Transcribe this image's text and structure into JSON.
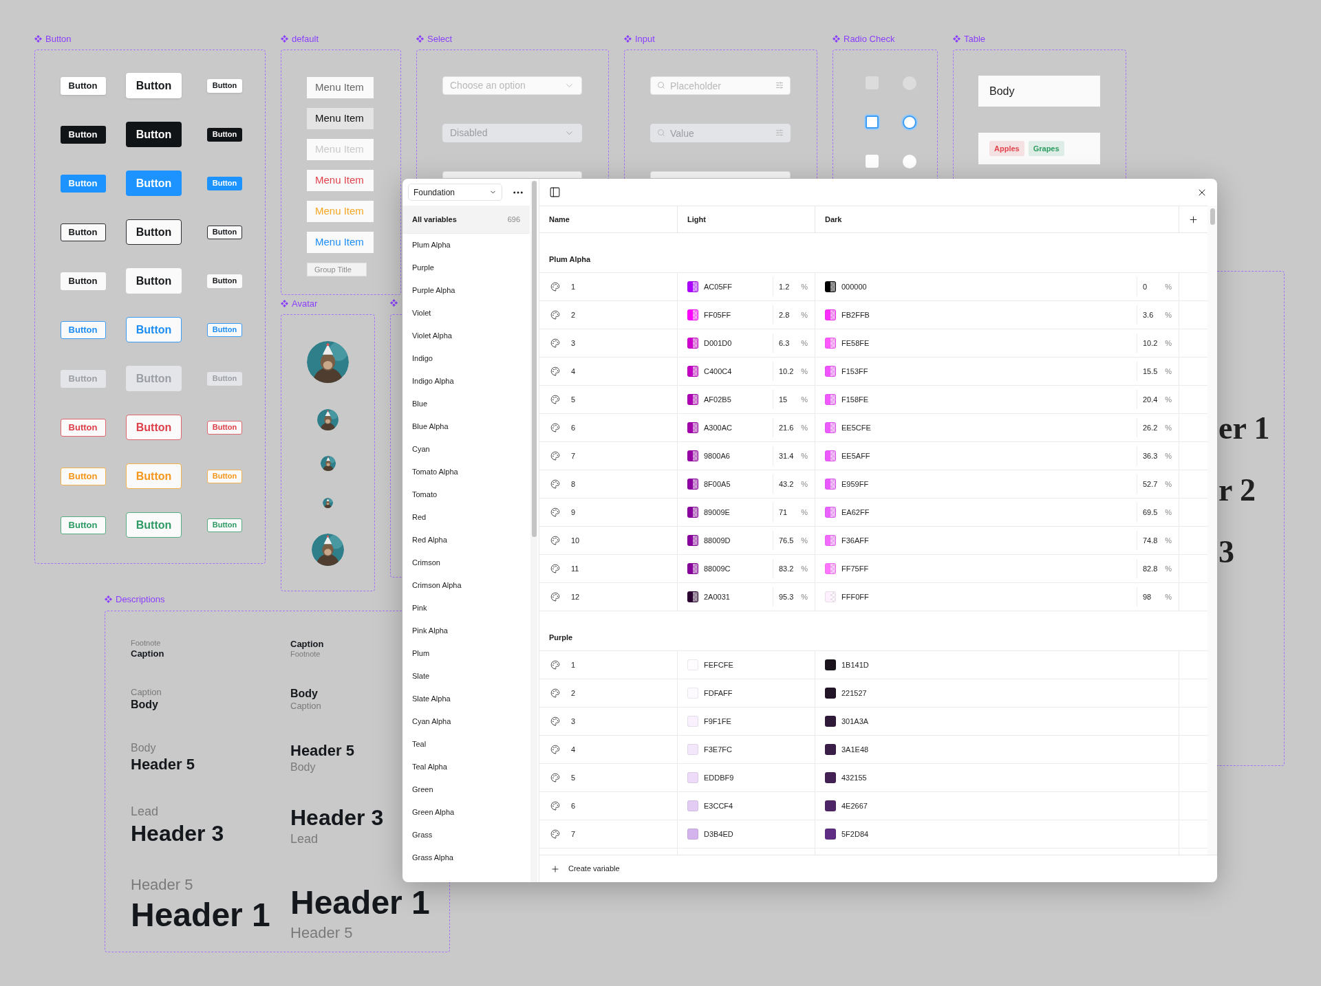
{
  "canvas": {
    "button_frame": {
      "label": "Button",
      "rows": [
        {
          "kind": "default",
          "buttons": [
            "Button",
            "Button",
            "Button"
          ]
        },
        {
          "kind": "dark",
          "buttons": [
            "Button",
            "Button",
            "Button"
          ]
        },
        {
          "kind": "primary",
          "buttons": [
            "Button",
            "Button",
            "Button"
          ]
        },
        {
          "kind": "outline",
          "buttons": [
            "Button",
            "Button",
            "Button"
          ]
        },
        {
          "kind": "plain",
          "buttons": [
            "Button",
            "Button",
            "Button"
          ]
        },
        {
          "kind": "link",
          "buttons": [
            "Button",
            "Button",
            "Button"
          ]
        },
        {
          "kind": "disabled",
          "buttons": [
            "Button",
            "Button",
            "Button"
          ]
        },
        {
          "kind": "danger",
          "buttons": [
            "Button",
            "Button",
            "Button"
          ]
        },
        {
          "kind": "warning",
          "buttons": [
            "Button",
            "Button",
            "Button"
          ]
        },
        {
          "kind": "success",
          "buttons": [
            "Button",
            "Button",
            "Button"
          ]
        }
      ]
    },
    "menu_frame": {
      "label": "default",
      "items": [
        {
          "text": "Menu Item",
          "kind": "default",
          "selected": false
        },
        {
          "text": "Menu Item",
          "kind": "default",
          "selected": true
        },
        {
          "text": "Menu Item",
          "kind": "disabled",
          "selected": false
        },
        {
          "text": "Menu Item",
          "kind": "danger",
          "selected": false
        },
        {
          "text": "Menu Item",
          "kind": "warning",
          "selected": false
        },
        {
          "text": "Menu Item",
          "kind": "primary",
          "selected": false
        },
        {
          "text": "Group Title",
          "kind": "group",
          "selected": false
        }
      ]
    },
    "select_frame": {
      "label": "Select",
      "fields": [
        {
          "kind": "default",
          "placeholder": "Choose an option"
        },
        {
          "kind": "disabled",
          "placeholder": "Disabled"
        },
        {
          "kind": "covered"
        }
      ]
    },
    "input_frame": {
      "label": "Input",
      "fields": [
        {
          "kind": "default",
          "placeholder": "Placeholder"
        },
        {
          "kind": "disabled",
          "value": "Value"
        },
        {
          "kind": "covered"
        }
      ]
    },
    "radio_frame": {
      "label": "Radio Check",
      "rows": [
        {
          "kind": "disabled",
          "checkbox": {
            "checked": false
          },
          "radio": {
            "checked": false
          }
        },
        {
          "kind": "focused",
          "checkbox": {
            "checked": false
          },
          "radio": {
            "checked": false
          }
        },
        {
          "kind": "default",
          "checkbox": {
            "checked": false
          },
          "radio": {
            "checked": false
          }
        }
      ]
    },
    "table_frame": {
      "label": "Table",
      "cell": "Body",
      "tags": [
        {
          "text": "Apples",
          "color": "#e0434d"
        },
        {
          "text": "Grapes",
          "color": "#2c9c62"
        }
      ]
    },
    "avatar_frame": {
      "label": "Avatar",
      "avatars": [
        {
          "kind": "xl"
        },
        {
          "kind": "md"
        },
        {
          "kind": "sm"
        },
        {
          "kind": "xs"
        },
        {
          "kind": "lg"
        }
      ]
    },
    "descriptions_frame": {
      "label": "Descriptions",
      "columns": [
        [
          [
            {
              "text": "Footnote",
              "kind": "footnote"
            },
            {
              "text": "Caption",
              "kind": "caption"
            }
          ],
          [
            {
              "text": "Caption",
              "kind": "caption"
            },
            {
              "text": "Body",
              "kind": "body"
            }
          ],
          [
            {
              "text": "Body",
              "kind": "body"
            },
            {
              "text": "Header 5",
              "kind": "h5"
            }
          ],
          [
            {
              "text": "Lead",
              "kind": "lead"
            },
            {
              "text": "Header 3",
              "kind": "h3"
            }
          ],
          [
            {
              "text": "Header 5",
              "kind": "h5"
            },
            {
              "text": "Header 1",
              "kind": "h1"
            }
          ]
        ],
        [
          [
            {
              "text": "Caption",
              "kind": "caption"
            },
            {
              "text": "Footnote",
              "kind": "footnote"
            }
          ],
          [
            {
              "text": "Body",
              "kind": "body"
            },
            {
              "text": "Caption",
              "kind": "caption"
            }
          ],
          [
            {
              "text": "Header 5",
              "kind": "h5"
            },
            {
              "text": "Body",
              "kind": "body"
            }
          ],
          [
            {
              "text": "Header 3",
              "kind": "h3"
            },
            {
              "text": "Lead",
              "kind": "lead"
            }
          ],
          [
            {
              "text": "Header 1",
              "kind": "h1"
            },
            {
              "text": "Header 5",
              "kind": "h5"
            }
          ]
        ]
      ]
    },
    "heading_frame": {
      "fragments": [
        "er 1",
        "r 2",
        "3"
      ]
    }
  },
  "variables_window": {
    "sidebar": {
      "collection": "Foundation",
      "all": {
        "label": "All variables",
        "count": "696",
        "selected": true
      },
      "groups": [
        {
          "label": "Plum Alpha",
          "selected": false
        },
        {
          "label": "Purple",
          "selected": false
        },
        {
          "label": "Purple Alpha",
          "selected": false
        },
        {
          "label": "Violet",
          "selected": false
        },
        {
          "label": "Violet Alpha",
          "selected": false
        },
        {
          "label": "Indigo",
          "selected": false
        },
        {
          "label": "Indigo Alpha",
          "selected": false
        },
        {
          "label": "Blue",
          "selected": false
        },
        {
          "label": "Blue Alpha",
          "selected": false
        },
        {
          "label": "Cyan",
          "selected": false
        },
        {
          "label": "Tomato Alpha",
          "selected": false
        },
        {
          "label": "Tomato",
          "selected": false
        },
        {
          "label": "Red",
          "selected": false
        },
        {
          "label": "Red Alpha",
          "selected": false
        },
        {
          "label": "Crimson",
          "selected": false
        },
        {
          "label": "Crimson Alpha",
          "selected": false
        },
        {
          "label": "Pink",
          "selected": false
        },
        {
          "label": "Pink Alpha",
          "selected": false
        },
        {
          "label": "Plum",
          "selected": false
        },
        {
          "label": "Slate",
          "selected": false
        },
        {
          "label": "Slate Alpha",
          "selected": false
        },
        {
          "label": "Cyan Alpha",
          "selected": false
        },
        {
          "label": "Teal",
          "selected": false
        },
        {
          "label": "Teal Alpha",
          "selected": false
        },
        {
          "label": "Green",
          "selected": false
        },
        {
          "label": "Green Alpha",
          "selected": false
        },
        {
          "label": "Grass",
          "selected": false
        },
        {
          "label": "Grass Alpha",
          "selected": false
        }
      ]
    },
    "table": {
      "columns": [
        "Name",
        "Light",
        "Dark"
      ],
      "groups": [
        {
          "title": "Plum Alpha",
          "rows": [
            {
              "name": "1",
              "light": {
                "hex": "AC05FF",
                "color": "#ac05ff",
                "alpha": "1.2",
                "unit": "%"
              },
              "dark": {
                "hex": "000000",
                "color": "#000000",
                "alpha": "0",
                "unit": "%"
              }
            },
            {
              "name": "2",
              "light": {
                "hex": "FF05FF",
                "color": "#ff05ff",
                "alpha": "2.8",
                "unit": "%"
              },
              "dark": {
                "hex": "FB2FFB",
                "color": "#fb2ffb",
                "alpha": "3.6",
                "unit": "%"
              }
            },
            {
              "name": "3",
              "light": {
                "hex": "D001D0",
                "color": "#d001d0",
                "alpha": "6.3",
                "unit": "%"
              },
              "dark": {
                "hex": "FE58FE",
                "color": "#fe58fe",
                "alpha": "10.2",
                "unit": "%"
              }
            },
            {
              "name": "4",
              "light": {
                "hex": "C400C4",
                "color": "#c400c4",
                "alpha": "10.2",
                "unit": "%"
              },
              "dark": {
                "hex": "F153FF",
                "color": "#f153ff",
                "alpha": "15.5",
                "unit": "%"
              }
            },
            {
              "name": "5",
              "light": {
                "hex": "AF02B5",
                "color": "#af02b5",
                "alpha": "15",
                "unit": "%"
              },
              "dark": {
                "hex": "F158FE",
                "color": "#f158fe",
                "alpha": "20.4",
                "unit": "%"
              }
            },
            {
              "name": "6",
              "light": {
                "hex": "A300AC",
                "color": "#a300ac",
                "alpha": "21.6",
                "unit": "%"
              },
              "dark": {
                "hex": "EE5CFE",
                "color": "#ee5cfe",
                "alpha": "26.2",
                "unit": "%"
              }
            },
            {
              "name": "7",
              "light": {
                "hex": "9800A6",
                "color": "#9800a6",
                "alpha": "31.4",
                "unit": "%"
              },
              "dark": {
                "hex": "EE5AFF",
                "color": "#ee5aff",
                "alpha": "36.3",
                "unit": "%"
              }
            },
            {
              "name": "8",
              "light": {
                "hex": "8F00A5",
                "color": "#8f00a5",
                "alpha": "43.2",
                "unit": "%"
              },
              "dark": {
                "hex": "E959FF",
                "color": "#e959ff",
                "alpha": "52.7",
                "unit": "%"
              }
            },
            {
              "name": "9",
              "light": {
                "hex": "89009E",
                "color": "#89009e",
                "alpha": "71",
                "unit": "%"
              },
              "dark": {
                "hex": "EA62FF",
                "color": "#ea62ff",
                "alpha": "69.5",
                "unit": "%"
              }
            },
            {
              "name": "10",
              "light": {
                "hex": "88009D",
                "color": "#88009d",
                "alpha": "76.5",
                "unit": "%"
              },
              "dark": {
                "hex": "F36AFF",
                "color": "#f36aff",
                "alpha": "74.8",
                "unit": "%"
              }
            },
            {
              "name": "11",
              "light": {
                "hex": "88009C",
                "color": "#88009c",
                "alpha": "83.2",
                "unit": "%"
              },
              "dark": {
                "hex": "FF75FF",
                "color": "#ff75ff",
                "alpha": "82.8",
                "unit": "%"
              }
            },
            {
              "name": "12",
              "light": {
                "hex": "2A0031",
                "color": "#2a0031",
                "alpha": "95.3",
                "unit": "%"
              },
              "dark": {
                "hex": "FFF0FF",
                "color": "#fff0ff",
                "alpha": "98",
                "unit": "%"
              }
            }
          ]
        },
        {
          "title": "Purple",
          "rows": [
            {
              "name": "1",
              "light": {
                "hex": "FEFCFE",
                "color": "#fefcfe"
              },
              "dark": {
                "hex": "1B141D",
                "color": "#1b141d"
              }
            },
            {
              "name": "2",
              "light": {
                "hex": "FDFAFF",
                "color": "#fdfaff"
              },
              "dark": {
                "hex": "221527",
                "color": "#221527"
              }
            },
            {
              "name": "3",
              "light": {
                "hex": "F9F1FE",
                "color": "#f9f1fe"
              },
              "dark": {
                "hex": "301A3A",
                "color": "#301a3a"
              }
            },
            {
              "name": "4",
              "light": {
                "hex": "F3E7FC",
                "color": "#f3e7fc"
              },
              "dark": {
                "hex": "3A1E48",
                "color": "#3a1e48"
              }
            },
            {
              "name": "5",
              "light": {
                "hex": "EDDBF9",
                "color": "#eddbf9"
              },
              "dark": {
                "hex": "432155",
                "color": "#432155"
              }
            },
            {
              "name": "6",
              "light": {
                "hex": "E3CCF4",
                "color": "#e3ccf4"
              },
              "dark": {
                "hex": "4E2667",
                "color": "#4e2667"
              }
            },
            {
              "name": "7",
              "light": {
                "hex": "D3B4ED",
                "color": "#d3b4ed"
              },
              "dark": {
                "hex": "5F2D84",
                "color": "#5f2d84"
              }
            }
          ]
        }
      ]
    },
    "footer": {
      "action": "Create variable"
    }
  }
}
